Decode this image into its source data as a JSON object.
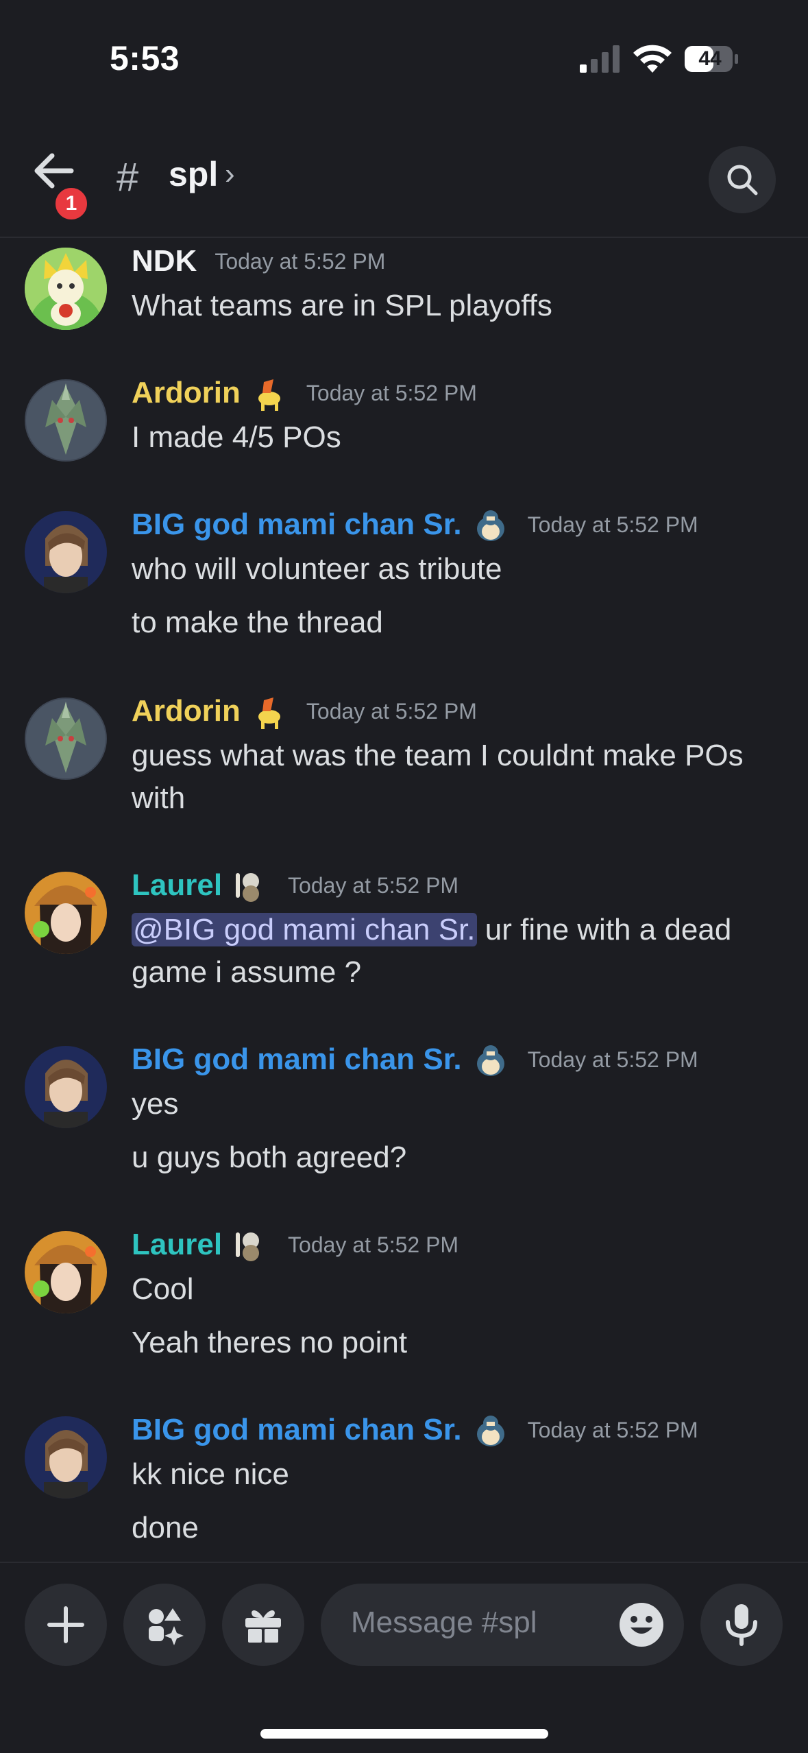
{
  "status_bar": {
    "time": "5:53",
    "battery": "44"
  },
  "header": {
    "back_badge": "1",
    "hash": "#",
    "channel_name": "spl",
    "chevron": "›"
  },
  "messages": [
    {
      "author": "NDK",
      "author_color": "#f2f3f5",
      "timestamp": "Today at 5:52 PM",
      "lines": [
        "What teams are in SPL playoffs"
      ],
      "avatar": "jirachi-avatar"
    },
    {
      "author": "Ardorin",
      "author_color": "#f0d15a",
      "timestamp": "Today at 5:52 PM",
      "lines": [
        "I made 4/5 POs"
      ],
      "avatar": "tyranitar-avatar"
    },
    {
      "author": "BIG god mami chan Sr.",
      "author_color": "#3a95ea",
      "timestamp": "Today at 5:52 PM",
      "lines": [
        "who will volunteer as tribute",
        "to make the thread"
      ],
      "avatar": "anime-man-avatar"
    },
    {
      "author": "Ardorin",
      "author_color": "#f0d15a",
      "timestamp": "Today at 5:52 PM",
      "lines": [
        "guess what was the team I couldnt make POs",
        "with"
      ],
      "avatar": "tyranitar-avatar"
    },
    {
      "author": "Laurel",
      "author_color": "#2ec4c0",
      "timestamp": "Today at 5:52 PM",
      "mention": "@BIG god mami chan Sr.",
      "lines": [
        " ur fine with a dead",
        "game i assume ?"
      ],
      "avatar": "anime-girl-avatar"
    },
    {
      "author": "BIG god mami chan Sr.",
      "author_color": "#3a95ea",
      "timestamp": "Today at 5:52 PM",
      "lines": [
        "yes",
        "u guys both agreed?"
      ],
      "avatar": "anime-man-avatar"
    },
    {
      "author": "Laurel",
      "author_color": "#2ec4c0",
      "timestamp": "Today at 5:52 PM",
      "lines": [
        "Cool",
        "Yeah theres no point"
      ],
      "avatar": "anime-girl-avatar"
    },
    {
      "author": "BIG god mami chan Sr.",
      "author_color": "#3a95ea",
      "timestamp": "Today at 5:52 PM",
      "lines": [
        "kk nice nice",
        "done"
      ],
      "avatar": "anime-man-avatar"
    }
  ],
  "input": {
    "placeholder": "Message #spl"
  }
}
